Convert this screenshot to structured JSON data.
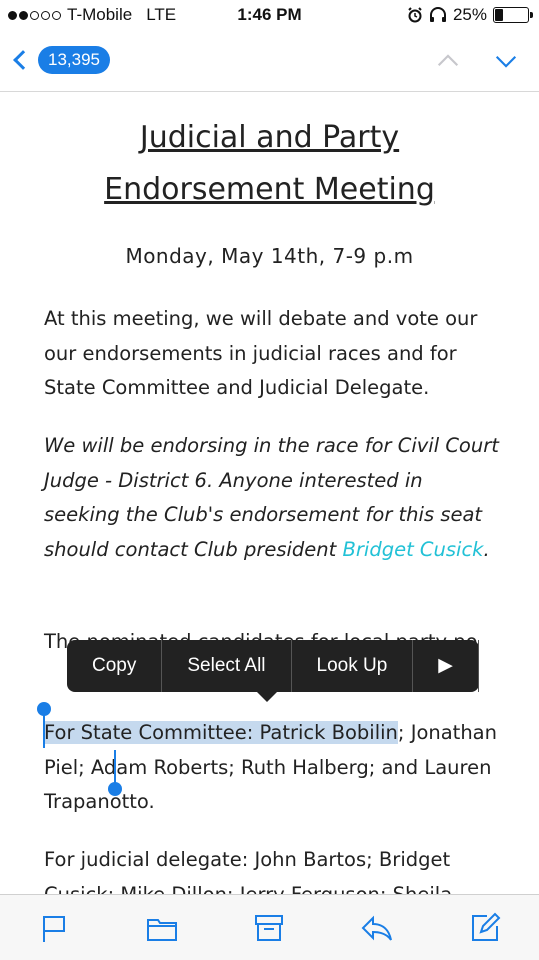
{
  "status_bar": {
    "carrier": "T-Mobile",
    "network": "LTE",
    "time": "1:46 PM",
    "battery": "25%",
    "battery_level": 0.25,
    "icons": [
      "alarm-icon",
      "headphones-icon"
    ]
  },
  "nav": {
    "back_count": "13,395",
    "icons": [
      "back-chevron-icon",
      "previous-message-icon",
      "next-message-icon"
    ]
  },
  "content": {
    "title_line1": "Judicial and Party",
    "title_line2": "Endorsement Meeting",
    "date": "Monday, May 14th, 7-9 p.m",
    "para1": "At this meeting, we will debate and vote our our endorsements in judicial races and for State Committee and Judicial Delegate.",
    "para2_text": "We will be endorsing in the race for Civil Court Judge - District 6. Anyone interested in seeking the Club's endorsement for this seat should contact Club president ",
    "para2_link": "Bridget Cusick",
    "para2_end": ".",
    "para3": "The nominated candidates for local party po",
    "para4_selected": "For State Committee: Patrick Bobilin",
    "para4_rest": "; Jonathan Piel; Adam Roberts; Ruth Halberg; and Lauren Trapanotto.",
    "para5": "For judicial delegate: John Bartos; Bridget Cusick; Mike Dillon; Jerry Ferguson; Sheila"
  },
  "edit_menu": {
    "copy": "Copy",
    "select_all": "Select All",
    "look_up": "Look Up",
    "more": "▶"
  },
  "toolbar": {
    "icons": [
      "flag-icon",
      "folder-icon",
      "archive-icon",
      "reply-icon",
      "compose-icon"
    ]
  },
  "colors": {
    "accent": "#1a7ee6",
    "link": "#22c1d6",
    "selection": "#c5d9ee"
  }
}
